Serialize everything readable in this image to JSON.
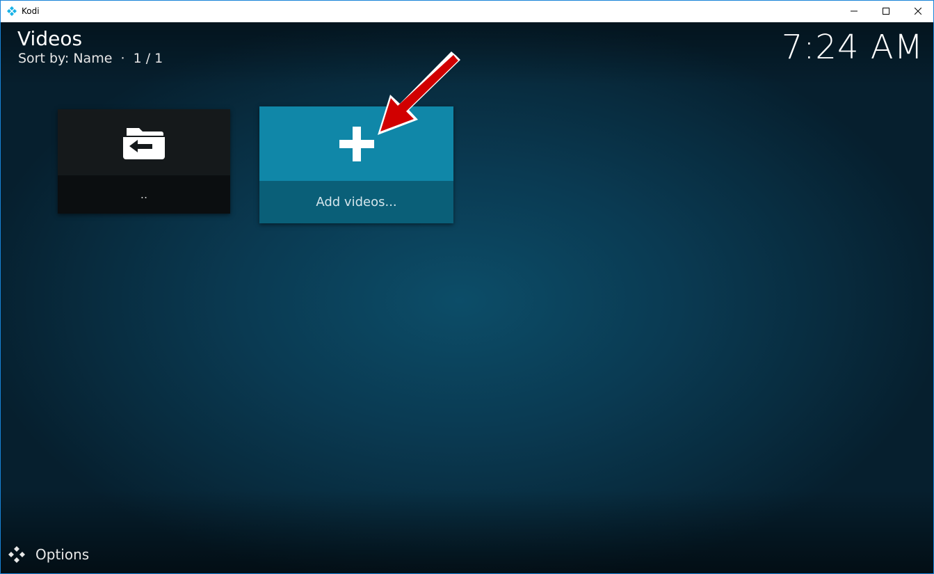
{
  "window": {
    "title": "Kodi"
  },
  "header": {
    "title": "Videos",
    "sort_info": "Sort by: Name  ·  1 / 1",
    "clock": "7:24 AM"
  },
  "tiles": [
    {
      "label": "..",
      "icon": "folder-back-icon"
    },
    {
      "label": "Add videos...",
      "icon": "plus-icon"
    }
  ],
  "footer": {
    "options_label": "Options"
  },
  "colors": {
    "accent": "#1087a8",
    "annotation_arrow": "#cc0000"
  }
}
